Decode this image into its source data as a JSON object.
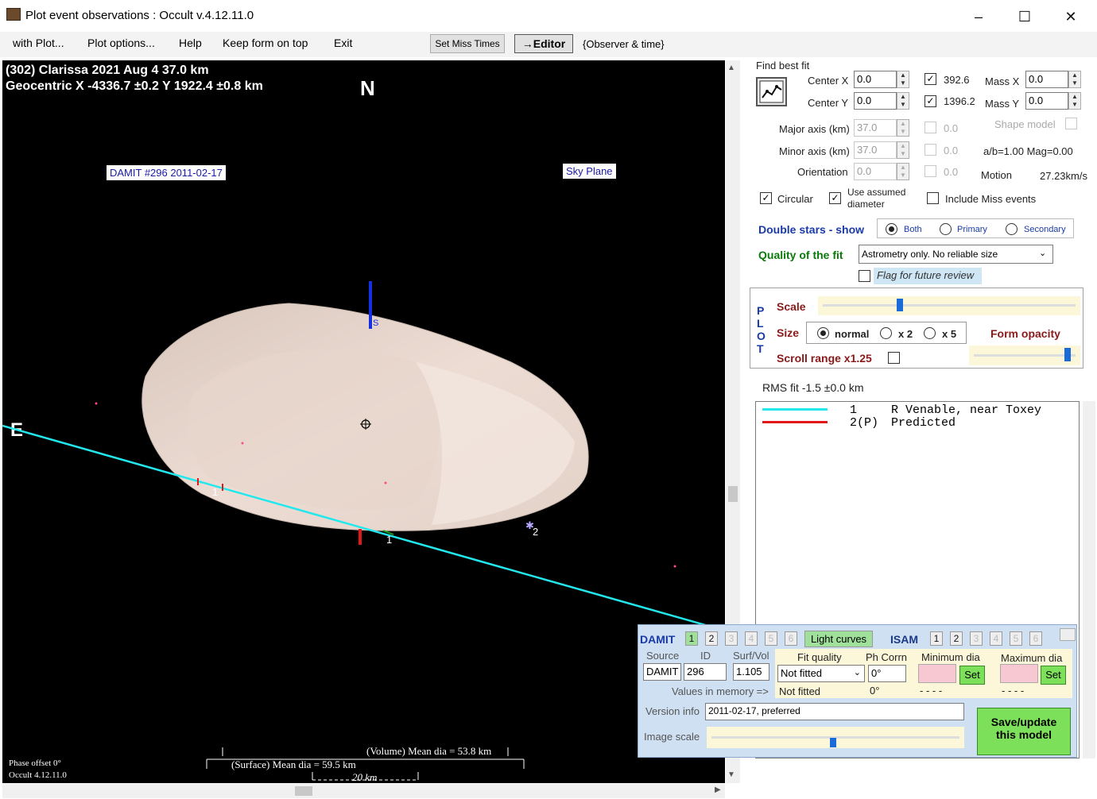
{
  "window": {
    "title": "Plot event observations : Occult v.4.12.11.0"
  },
  "menu": {
    "items": [
      "with Plot...",
      "Plot options...",
      "Help",
      "Keep form on top",
      "Exit"
    ],
    "btn_miss": "Set Miss Times",
    "btn_editor": "→Editor",
    "btn_observer": "{Observer & time}"
  },
  "plot": {
    "line1": "(302) Clarissa  2021 Aug 4   37.0 km",
    "line2": "Geocentric  X  -4336.7 ±0.2  Y 1922.4 ±0.8 km",
    "north": "N",
    "east": "E",
    "damit_label": "DAMIT #296 2011-02-17",
    "sky_plane": "Sky Plane",
    "axis_s": "S",
    "chord1a": "1",
    "chord1b": "1",
    "chord2": "2",
    "vol_dia": "(Volume) Mean dia = 53.8 km",
    "surf_dia": "(Surface) Mean dia = 59.5 km",
    "scale_km": "20  km",
    "phase": "Phase offset 0°",
    "occult_ver": "Occult 4.12.11.0"
  },
  "fit": {
    "find_best_fit": "Find best fit",
    "center_x_label": "Center X",
    "center_x": "0.0",
    "center_y_label": "Center Y",
    "center_y": "0.0",
    "cb1_val": "392.6",
    "cb2_val": "1396.2",
    "mass_x_label": "Mass X",
    "mass_x": "0.0",
    "mass_y_label": "Mass Y",
    "mass_y": "0.0",
    "major_label": "Major axis (km)",
    "major": "37.0",
    "minor_label": "Minor axis (km)",
    "minor": "37.0",
    "orient_label": "Orientation",
    "orient": "0.0",
    "dis1": "0.0",
    "dis2": "0.0",
    "dis3": "0.0",
    "shape_model": "Shape model",
    "ab": "a/b=1.00  Mag=0.00",
    "motion_label": "Motion",
    "motion": "27.23km/s",
    "circular": "Circular",
    "use_assumed": "Use assumed diameter",
    "include_miss": "Include Miss events",
    "double_stars": "Double stars - show",
    "both": "Both",
    "primary": "Primary",
    "secondary": "Secondary",
    "quality_label": "Quality of the fit",
    "quality_value": "Astrometry only. No reliable size",
    "flag_review": "Flag for future review"
  },
  "plot_opts": {
    "p": "P",
    "l": "L",
    "o": "O",
    "t": "T",
    "scale": "Scale",
    "size": "Size",
    "normal": "normal",
    "x2": "x 2",
    "x5": "x 5",
    "form_opacity": "Form opacity",
    "scroll_range": "Scroll range x1.25",
    "scale_level": 0.3,
    "opacity_level": 0.95
  },
  "rms": "RMS fit -1.5 ±0.0 km",
  "legend": [
    {
      "num": "1",
      "text": "R Venable, near Toxey",
      "color": "#22e8ee"
    },
    {
      "num": "2(P)",
      "text": "Predicted",
      "color": "#e01818"
    }
  ],
  "damit": {
    "title": "DAMIT",
    "tabs": [
      "1",
      "2",
      "3",
      "4",
      "5",
      "6"
    ],
    "light_curves": "Light curves",
    "isam": "ISAM",
    "isam_tabs": [
      "1",
      "2",
      "3",
      "4",
      "5",
      "6"
    ],
    "source_label": "Source",
    "id_label": "ID",
    "surfvol_label": "Surf/Vol",
    "source": "DAMIT",
    "id": "296",
    "surfvol": "1.105",
    "fit_quality_label": "Fit quality",
    "phcorr_label": "Ph Corrn",
    "min_dia_label": "Minimum dia",
    "max_dia_label": "Maximum dia",
    "fit_quality": "Not fitted",
    "phcorr": "0°",
    "fit_quality2": "Not fitted",
    "phcorr2": "0°",
    "dash1": "- - - -",
    "dash2": "- - - -",
    "set": "Set",
    "values_mem": "Values in memory =>",
    "version_label": "Version info",
    "version": "2011-02-17, preferred",
    "image_scale": "Image scale",
    "save": "Save/update this model",
    "image_scale_level": 0.49
  }
}
